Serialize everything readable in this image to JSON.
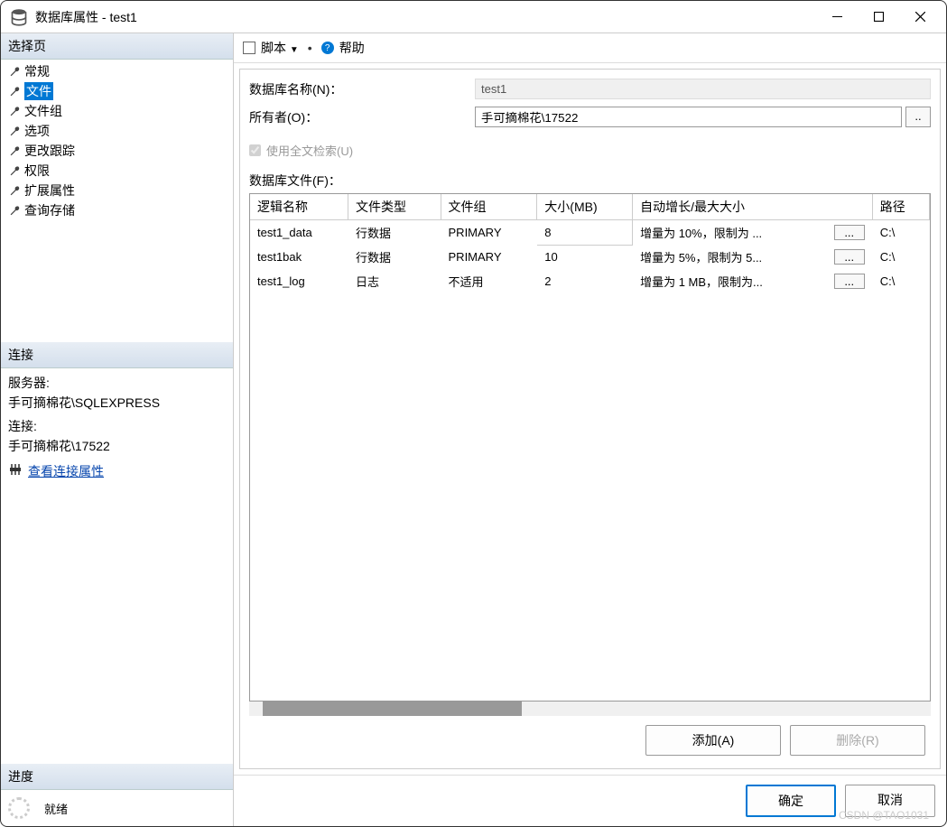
{
  "window": {
    "title": "数据库属性 - test1"
  },
  "sidebar": {
    "select_page_header": "选择页",
    "items": [
      {
        "label": "常规"
      },
      {
        "label": "文件",
        "selected": true
      },
      {
        "label": "文件组"
      },
      {
        "label": "选项"
      },
      {
        "label": "更改跟踪"
      },
      {
        "label": "权限"
      },
      {
        "label": "扩展属性"
      },
      {
        "label": "查询存储"
      }
    ],
    "connection_header": "连接",
    "server_label": "服务器:",
    "server_value": "手可摘棉花\\SQLEXPRESS",
    "connection_label": "连接:",
    "connection_value": "手可摘棉花\\17522",
    "view_conn_props": "查看连接属性",
    "progress_header": "进度",
    "progress_status": "就绪"
  },
  "toolbar": {
    "script_label": "脚本",
    "help_label": "帮助"
  },
  "form": {
    "db_name_label": "数据库名称(N)：",
    "db_name_value": "test1",
    "owner_label": "所有者(O)：",
    "owner_value": "手可摘棉花\\17522",
    "ellipsis": "..",
    "fulltext_label": "使用全文检索(U)",
    "files_section_label": "数据库文件(F)："
  },
  "table": {
    "headers": {
      "logical_name": "逻辑名称",
      "file_type": "文件类型",
      "filegroup": "文件组",
      "size": "大小(MB)",
      "autogrowth": "自动增长/最大大小",
      "path": "路径"
    },
    "rows": [
      {
        "logical_name": "test1_data",
        "file_type": "行数据",
        "filegroup": "PRIMARY",
        "size": "8",
        "autogrowth": "增量为 10%，限制为 ...",
        "path": "C:\\"
      },
      {
        "logical_name": "test1bak",
        "file_type": "行数据",
        "filegroup": "PRIMARY",
        "size": "10",
        "autogrowth": "增量为 5%，限制为 5...",
        "path": "C:\\"
      },
      {
        "logical_name": "test1_log",
        "file_type": "日志",
        "filegroup": "不适用",
        "size": "2",
        "autogrowth": "增量为 1 MB，限制为...",
        "path": "C:\\"
      }
    ],
    "row_ellipsis": "..."
  },
  "buttons": {
    "add": "添加(A)",
    "remove": "删除(R)",
    "ok": "确定",
    "cancel": "取消"
  },
  "watermark": "CSDN @TAO1031"
}
